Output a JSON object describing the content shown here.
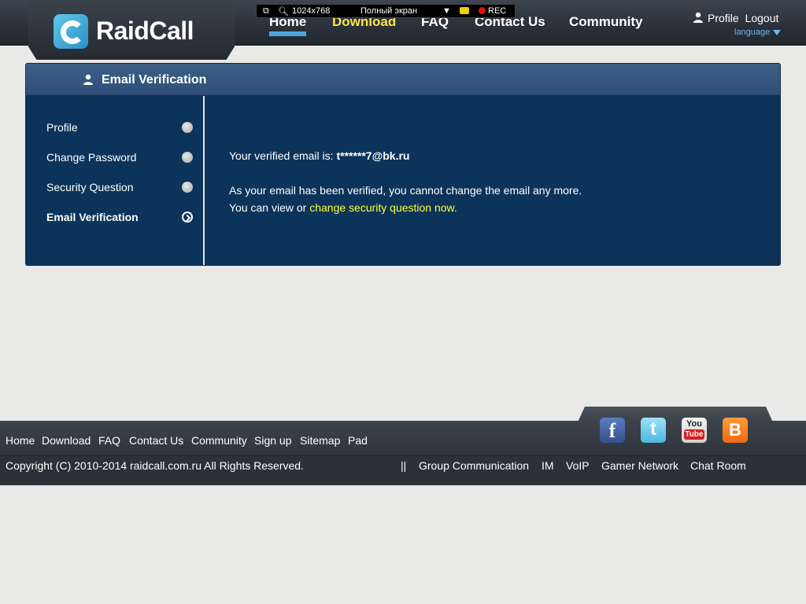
{
  "brand": {
    "name": "RaidCall"
  },
  "nav": [
    {
      "label": "Home",
      "active": true
    },
    {
      "label": "Download",
      "highlight": true
    },
    {
      "label": "FAQ"
    },
    {
      "label": "Contact Us"
    },
    {
      "label": "Community"
    }
  ],
  "user_links": {
    "profile": "Profile",
    "logout": "Logout",
    "language": "language"
  },
  "recorder": {
    "resolution": "1024x768",
    "mode": "Полный экран",
    "rec": "REC"
  },
  "panel": {
    "title": "Email Verification",
    "sidebar": [
      {
        "label": "Profile"
      },
      {
        "label": "Change Password"
      },
      {
        "label": "Security Question"
      },
      {
        "label": "Email Verification",
        "active": true
      }
    ],
    "content": {
      "verified_prefix": "Your verified email is: ",
      "email": "t******7@bk.ru",
      "notice": "As your email has been verified, you cannot change the email any more.",
      "view_prefix": "You can view or ",
      "view_link": "change security question now",
      "view_suffix": "."
    }
  },
  "footer": {
    "links": [
      "Home",
      "Download",
      "FAQ",
      "Contact Us",
      "Community",
      "Sign up",
      "Sitemap",
      "Pad"
    ],
    "copyright": "Copyright (C) 2010-2014 raidcall.com.ru All Rights Reserved.",
    "separator": "||",
    "bottom_links": [
      "Group Communication",
      "IM",
      "VoIP",
      "Gamer Network",
      "Chat Room"
    ],
    "social": {
      "facebook_glyph": "f",
      "twitter_glyph": "t",
      "youtube_top": "You",
      "youtube_bottom": "Tube",
      "blogger_glyph": "B"
    }
  },
  "colors": {
    "header": "#2a3038",
    "panel": "#0c345a",
    "panel_head": "#35577f",
    "link_yellow": "#ffff33",
    "nav_active": "#4aa8e0"
  }
}
